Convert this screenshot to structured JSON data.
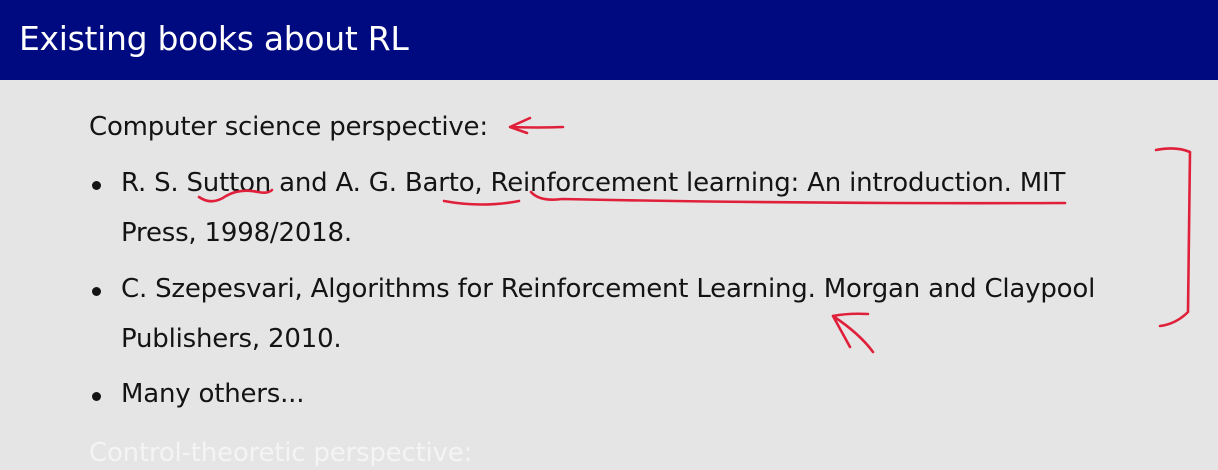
{
  "slide": {
    "title": "Existing books about RL",
    "section_cs": "Computer science perspective:",
    "books": [
      {
        "line1": "R. S. Sutton and A. G. Barto, Reinforcement learning: An introduction. MIT",
        "line2": "Press, 1998/2018."
      },
      {
        "line1": "C. Szepesvari, Algorithms for Reinforcement Learning. Morgan and Claypool",
        "line2": "Publishers, 2010."
      },
      {
        "line1": "Many others..."
      }
    ],
    "section_control": "Control-theoretic perspective:"
  },
  "colors": {
    "title_bar": "#000a80",
    "background": "#e5e5e5",
    "annotation_ink": "#e0203a"
  }
}
